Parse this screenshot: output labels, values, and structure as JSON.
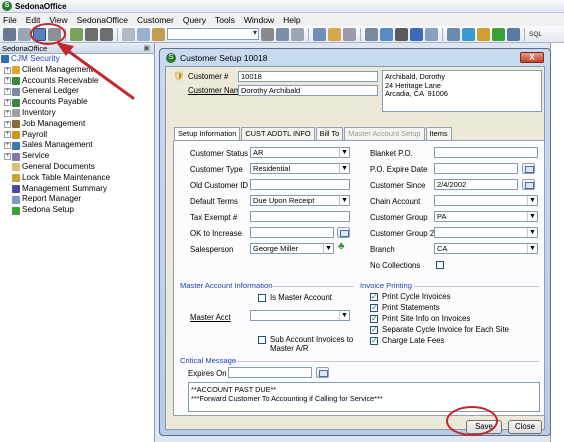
{
  "app": {
    "title": "SedonaOffice"
  },
  "menu": [
    "File",
    "Edit",
    "View",
    "SedonaOffice",
    "Customer",
    "Query",
    "Tools",
    "Window",
    "Help"
  ],
  "toolbar": {
    "sql_label": "SQL"
  },
  "left_panel": {
    "header": "SedonaOffice",
    "items": [
      {
        "label": "CJM Security",
        "expander": "",
        "color": "#2b6cc4"
      },
      {
        "label": "Client Management",
        "expander": "+",
        "color": "#e2a32b"
      },
      {
        "label": "Accounts Receivable",
        "expander": "+",
        "color": "#3a8a3a"
      },
      {
        "label": "General Ledger",
        "expander": "+",
        "color": "#7a8aa0"
      },
      {
        "label": "Accounts Payable",
        "expander": "+",
        "color": "#3a8a3a"
      },
      {
        "label": "Inventory",
        "expander": "+",
        "color": "#a0a0a0"
      },
      {
        "label": "Job Management",
        "expander": "+",
        "color": "#8a6a3a"
      },
      {
        "label": "Payroll",
        "expander": "+",
        "color": "#c99a1a"
      },
      {
        "label": "Sales Management",
        "expander": "+",
        "color": "#3a7ab0"
      },
      {
        "label": "Service",
        "expander": "+",
        "color": "#7a7ab0"
      },
      {
        "label": "General Documents",
        "expander": "",
        "color": "#d8c070"
      },
      {
        "label": "Lock Table Maintenance",
        "expander": "",
        "color": "#c9a23a"
      },
      {
        "label": "Management Summary",
        "expander": "",
        "color": "#4a4aa0"
      },
      {
        "label": "Report Manager",
        "expander": "",
        "color": "#7a9ac4"
      },
      {
        "label": "Sedona Setup",
        "expander": "",
        "color": "#3aa03a"
      }
    ]
  },
  "dialog": {
    "title": "Customer Setup 10018",
    "close": "X",
    "customer_number_label": "Customer #",
    "customer_number": "10018",
    "customer_name_label": "Customer Name",
    "customer_name": "Dorothy Archibald",
    "address": "Archibald, Dorothy\n24 Heritage Lane\nArcadia, CA  91006",
    "tabs": [
      {
        "label": "Setup Information",
        "active": true,
        "disabled": false
      },
      {
        "label": "CUST ADDTL INFO",
        "active": false,
        "disabled": false
      },
      {
        "label": "Bill To",
        "active": false,
        "disabled": false
      },
      {
        "label": "Master Account Setup",
        "active": false,
        "disabled": true
      },
      {
        "label": "Items",
        "active": false,
        "disabled": false
      }
    ],
    "left_fields": {
      "customer_status": {
        "label": "Customer Status",
        "value": "AR"
      },
      "customer_type": {
        "label": "Customer Type",
        "value": "Residential"
      },
      "old_customer_id": {
        "label": "Old Customer ID",
        "value": ""
      },
      "default_terms": {
        "label": "Default Terms",
        "value": "Due Upon Receipt"
      },
      "tax_exempt": {
        "label": "Tax Exempt #",
        "value": ""
      },
      "ok_to_increase": {
        "label": "OK to Increase",
        "value": ""
      },
      "salesperson": {
        "label": "Salesperson",
        "value": "George Miller"
      }
    },
    "right_fields": {
      "blanket_po": {
        "label": "Blanket P.O.",
        "value": ""
      },
      "po_expire_date": {
        "label": "P.O. Expire Date",
        "value": ""
      },
      "customer_since": {
        "label": "Customer Since",
        "value": "2/4/2002"
      },
      "chain_account": {
        "label": "Chain Account",
        "value": ""
      },
      "customer_group": {
        "label": "Customer Group",
        "value": "PA"
      },
      "customer_group_2": {
        "label": "Customer Group 2",
        "value": ""
      },
      "branch": {
        "label": "Branch",
        "value": "CA"
      },
      "no_collections": {
        "label": "No Collections",
        "checked": false
      }
    },
    "master_account": {
      "section_label": "Master Account Information",
      "is_master_label": "Is Master Account",
      "is_master_checked": false,
      "master_acct_label": "Master Acct",
      "master_acct_value": "",
      "sub_account_label": "Sub Account Invoices to\nMaster A/R",
      "sub_account_checked": false
    },
    "invoice_printing": {
      "section_label": "Invoice Printing",
      "options": [
        {
          "label": "Print Cycle Invoices",
          "checked": true
        },
        {
          "label": "Print Statements",
          "checked": true
        },
        {
          "label": "Print Site Info on Invoices",
          "checked": true
        },
        {
          "label": "Separate Cycle Invoice for Each Site",
          "checked": true
        },
        {
          "label": "Charge Late Fees",
          "checked": true
        }
      ]
    },
    "critical_message": {
      "section_label": "Critical Message",
      "expires_label": "Expires On",
      "expires_value": "",
      "text": "**ACCOUNT PAST DUE**\n***Forward Customer To Accounting if Calling for Service***"
    },
    "save_label": "Save",
    "close_label": "Close"
  },
  "colors": {
    "annotation": "#c0292b",
    "section": "#1f3fbf"
  }
}
